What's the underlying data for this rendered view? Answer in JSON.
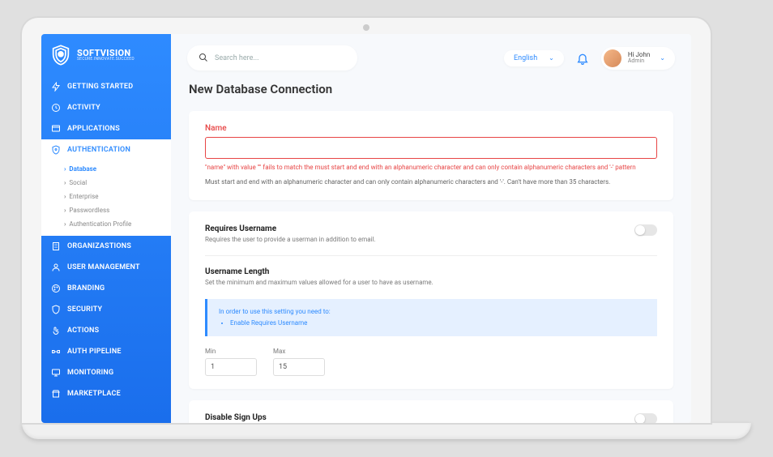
{
  "brand": {
    "name": "SOFTVISION",
    "tagline": "SECURE.INNOVATE.SUCCEED"
  },
  "sidebar": {
    "items": [
      {
        "label": "GETTING STARTED"
      },
      {
        "label": "ACTIVITY"
      },
      {
        "label": "APPLICATIONS"
      },
      {
        "label": "AUTHENTICATION"
      },
      {
        "label": "ORGANIZASTIONS"
      },
      {
        "label": "USER MANAGEMENT"
      },
      {
        "label": "BRANDING"
      },
      {
        "label": "SECURITY"
      },
      {
        "label": "ACTIONS"
      },
      {
        "label": "AUTH PIPELINE"
      },
      {
        "label": "MONITORING"
      },
      {
        "label": "MARKETPLACE"
      }
    ],
    "auth_sub": [
      {
        "label": "Database",
        "active": true
      },
      {
        "label": "Social"
      },
      {
        "label": "Enterprise"
      },
      {
        "label": "Passwordless"
      },
      {
        "label": "Authentication Profile"
      }
    ]
  },
  "topbar": {
    "search_placeholder": "Search here...",
    "language": "English",
    "user_greet": "Hi John",
    "user_role": "Admin"
  },
  "page": {
    "title": "New Database Connection"
  },
  "form": {
    "name": {
      "label": "Name",
      "value": "",
      "error": "\"name\" with value \"\" fails to match the must start and end with an alphanumeric character and can only contain alphanumeric characters and '-' pattern",
      "help": "Must start and end with an alphanumeric character and can only contain alphanumeric characters and '-'. Can't have more than 35 characters."
    },
    "requires_username": {
      "title": "Requires Username",
      "desc": "Requires the user to provide a userman in addition to email.",
      "value": false
    },
    "username_length": {
      "title": "Username Length",
      "desc": "Set the minimum and maximum values allowed for a user to have as username.",
      "info_heading": "In order to use this setting you need to:",
      "info_item": "Enable Requires Username",
      "min_label": "Min",
      "min_value": "1",
      "max_label": "Max",
      "max_value": "15"
    },
    "disable_signups": {
      "title": "Disable Sign Ups"
    }
  }
}
